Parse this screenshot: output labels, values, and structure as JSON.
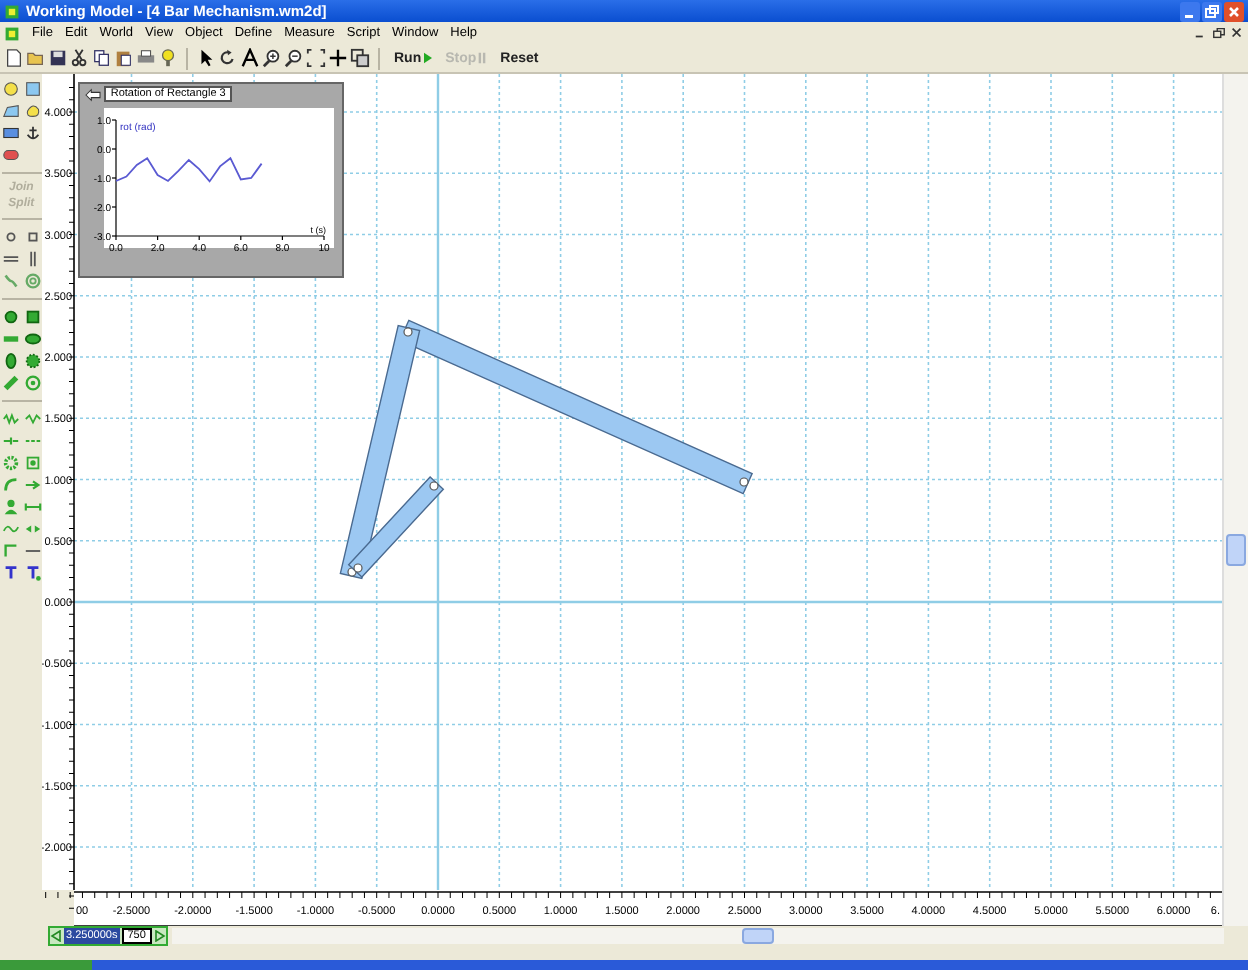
{
  "window": {
    "title": "Working Model - [4 Bar Mechanism.wm2d]"
  },
  "menu": [
    "File",
    "Edit",
    "World",
    "View",
    "Object",
    "Define",
    "Measure",
    "Script",
    "Window",
    "Help"
  ],
  "toolbar": {
    "run": {
      "label": "Run",
      "disabled": false
    },
    "stop": {
      "label": "Stop",
      "disabled": true
    },
    "reset": {
      "label": "Reset",
      "disabled": false
    }
  },
  "palette": {
    "join": {
      "label": "Join",
      "disabled": true
    },
    "split": {
      "label": "Split",
      "disabled": true
    }
  },
  "graph": {
    "title": "Rotation of Rectangle 3",
    "chart_data": {
      "type": "line",
      "ylabel": "rot (rad)",
      "xlabel": "t (s)",
      "x": [
        0,
        0.5,
        1.0,
        1.5,
        2.0,
        2.5,
        3.0,
        3.5,
        4.0,
        4.5,
        5.0,
        5.5,
        6.0,
        6.5,
        7.0
      ],
      "series": [
        {
          "color": "#5a5ad2",
          "values": [
            -1.1,
            -0.95,
            -0.55,
            -0.32,
            -0.9,
            -1.1,
            -0.75,
            -0.38,
            -0.7,
            -1.12,
            -0.6,
            -0.32,
            -1.05,
            -1.0,
            -0.5
          ]
        }
      ],
      "xlim": [
        0,
        10
      ],
      "ylim": [
        -3,
        1
      ],
      "xticks": [
        {
          "value": 0,
          "label": "0.0"
        },
        {
          "value": 2,
          "label": "2.0"
        },
        {
          "value": 4,
          "label": "4.0"
        },
        {
          "value": 6,
          "label": "6.0"
        },
        {
          "value": 8,
          "label": "8.0"
        },
        {
          "value": 10,
          "label": "10"
        }
      ],
      "yticks": [
        {
          "value": 1,
          "label": "1.0"
        },
        {
          "value": 0,
          "label": "0.0"
        },
        {
          "value": -1,
          "label": "-1.0"
        },
        {
          "value": -2,
          "label": "-2.0"
        },
        {
          "value": -3,
          "label": "-3.0"
        }
      ]
    }
  },
  "rulers": {
    "y_labels": [
      "4.000",
      "3.500",
      "3.000",
      "2.500",
      "2.000",
      "1.500",
      "1.000",
      "0.500",
      "0.000",
      "-0.500",
      "-1.000",
      "-1.500",
      "-2.000"
    ],
    "x_labels": [
      "00",
      "-2.5000",
      "-2.0000",
      "-1.5000",
      "-1.0000",
      "-0.5000",
      "0.0000",
      "0.5000",
      "1.0000",
      "1.5000",
      "2.0000",
      "2.5000",
      "3.0000",
      "3.5000",
      "4.0000",
      "4.5000",
      "5.0000",
      "5.5000",
      "6.0000",
      "6."
    ]
  },
  "tape": {
    "time": "3.250000s",
    "frame": "750"
  }
}
